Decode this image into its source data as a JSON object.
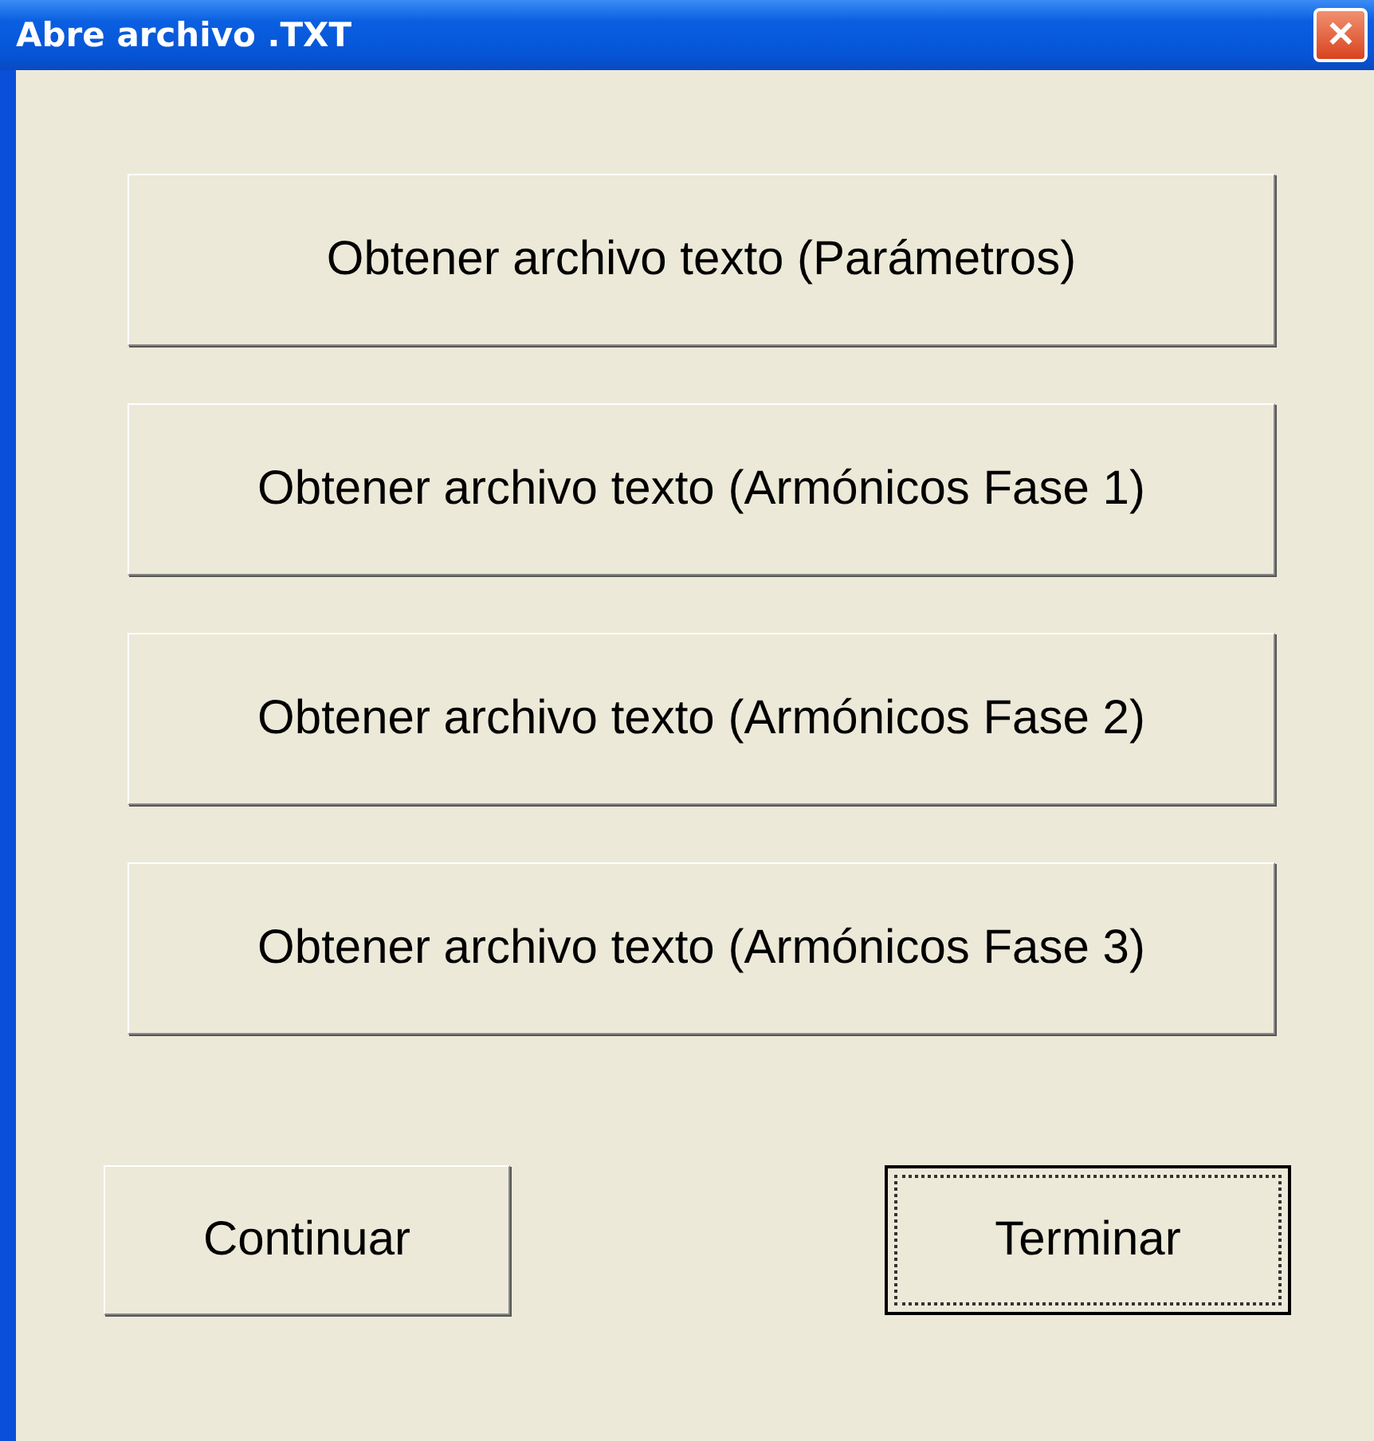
{
  "window": {
    "title": "Abre archivo .TXT",
    "close": "✕"
  },
  "file_buttons": [
    {
      "label": "Obtener archivo texto (Parámetros)",
      "focused": false
    },
    {
      "label": "Obtener archivo texto (Armónicos Fase 1)",
      "focused": false
    },
    {
      "label": "Obtener archivo texto (Armónicos Fase 2)",
      "focused": false
    },
    {
      "label": "Obtener archivo texto (Armónicos Fase 3)",
      "focused": false
    }
  ],
  "action_buttons": [
    {
      "label": "Continuar",
      "focused": false
    },
    {
      "label": "Terminar",
      "focused": true
    }
  ]
}
